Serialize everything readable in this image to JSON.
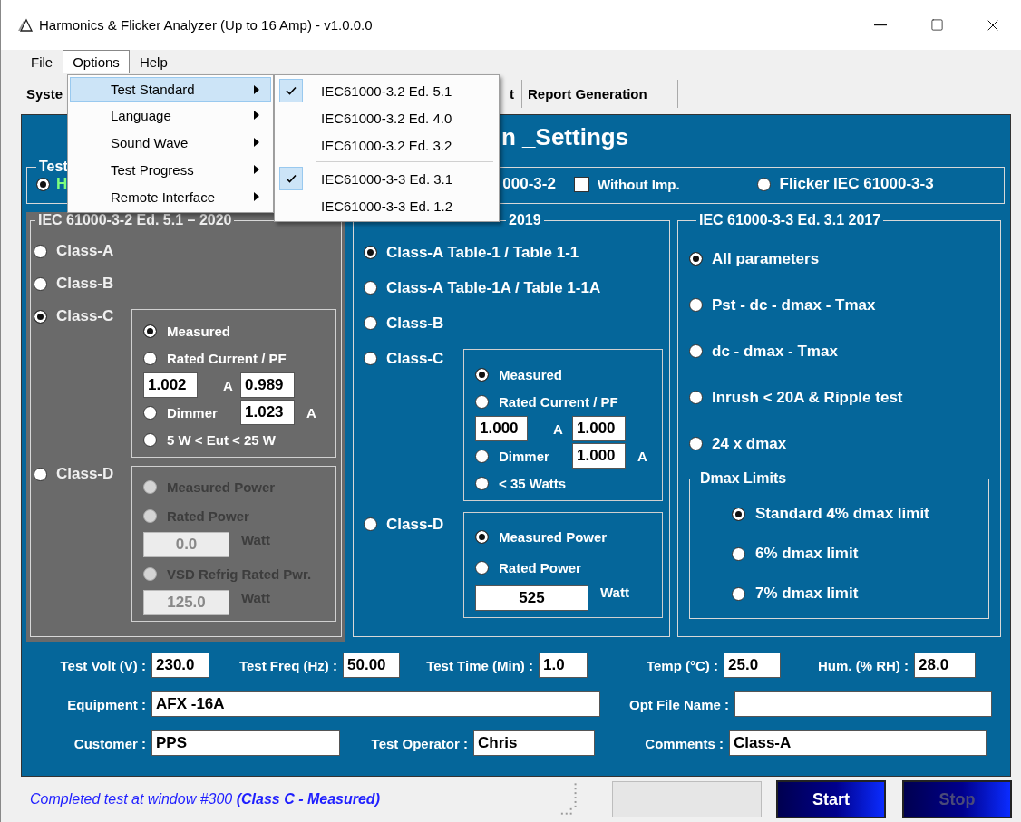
{
  "window": {
    "title": "Harmonics & Flicker Analyzer (Up to 16 Amp) - v1.0.0.0"
  },
  "menu_bar": [
    {
      "label": "File",
      "selected": false
    },
    {
      "label": "Options",
      "selected": true
    },
    {
      "label": "Help",
      "selected": false
    }
  ],
  "options_menu": [
    {
      "label": "Test Standard",
      "selected": true
    },
    {
      "label": "Language",
      "selected": false
    },
    {
      "label": "Sound Wave",
      "selected": false
    },
    {
      "label": "Test Progress",
      "selected": false
    },
    {
      "label": "Remote Interface",
      "selected": false
    }
  ],
  "test_standard_submenu": [
    {
      "label": "IEC61000-3.2 Ed. 5.1",
      "checked": true,
      "separator_before": false
    },
    {
      "label": "IEC61000-3.2 Ed. 4.0",
      "checked": false,
      "separator_before": false
    },
    {
      "label": "IEC61000-3.2 Ed. 3.2",
      "checked": false,
      "separator_before": false
    },
    {
      "label": "IEC61000-3-3 Ed. 3.1",
      "checked": true,
      "separator_before": true
    },
    {
      "label": "IEC61000-3-3 Ed. 1.2",
      "checked": false,
      "separator_before": false
    }
  ],
  "tabs": [
    {
      "label": "Syste",
      "selected": false
    },
    {
      "label": "t",
      "selected": false
    },
    {
      "label": "Report Generation",
      "selected": false
    }
  ],
  "panel_title": "n _Settings",
  "test_type": {
    "legend": "Test",
    "harmonics": {
      "label_start": "H",
      "label_end": "000-3-2",
      "selected": true
    },
    "without_imp": {
      "label": "Without Imp.",
      "checked": false
    },
    "flicker": {
      "label": "Flicker IEC 61000-3-3",
      "selected": false
    }
  },
  "columns": [
    {
      "legend": "IEC 61000-3-2 Ed. 5.1 – 2020",
      "active": false,
      "classes": [
        {
          "label": "Class-A",
          "selected": false
        },
        {
          "label": "Class-B",
          "selected": false
        },
        {
          "label": "Class-C",
          "selected": true,
          "options": {
            "disabled": false,
            "rows": [
              {
                "kind": "radio",
                "label": "Measured",
                "selected": true
              },
              {
                "kind": "radio",
                "label": "Rated Current / PF",
                "selected": false
              },
              {
                "kind": "pair",
                "value": "1.002",
                "unit": "A",
                "value2": "0.989"
              },
              {
                "kind": "radio_value",
                "label": "Dimmer",
                "selected": false,
                "value": "1.023",
                "unit": "A"
              },
              {
                "kind": "radio",
                "label": "5 W < Eut <  25 W",
                "selected": false
              }
            ]
          }
        },
        {
          "label": "Class-D",
          "selected": false,
          "options": {
            "disabled": true,
            "rows": [
              {
                "kind": "radio",
                "label": "Measured Power",
                "selected": false
              },
              {
                "kind": "radio",
                "label": "Rated Power",
                "selected": false
              },
              {
                "kind": "value",
                "value": "0.0",
                "unit": "Watt"
              },
              {
                "kind": "radio",
                "label": "VSD Refrig Rated Pwr.",
                "selected": false
              },
              {
                "kind": "value",
                "value": "125.0",
                "unit": "Watt"
              }
            ]
          }
        }
      ]
    },
    {
      "legend": "2019",
      "active": true,
      "classes": [
        {
          "label": "Class-A Table-1 / Table 1-1",
          "selected": true
        },
        {
          "label": "Class-A Table-1A / Table 1-1A",
          "selected": false
        },
        {
          "label": "Class-B",
          "selected": false
        },
        {
          "label": "Class-C",
          "selected": false,
          "options": {
            "disabled": false,
            "rows": [
              {
                "kind": "radio",
                "label": "Measured",
                "selected": true
              },
              {
                "kind": "radio",
                "label": "Rated Current / PF",
                "selected": false
              },
              {
                "kind": "pair",
                "value": "1.000",
                "unit": "A",
                "value2": "1.000"
              },
              {
                "kind": "radio_value",
                "label": "Dimmer",
                "selected": false,
                "value": "1.000",
                "unit": "A"
              },
              {
                "kind": "radio",
                "label": "< 35 Watts",
                "selected": false
              }
            ]
          }
        },
        {
          "label": "Class-D",
          "selected": false,
          "options": {
            "disabled": false,
            "rows": [
              {
                "kind": "radio",
                "label": "Measured Power",
                "selected": true
              },
              {
                "kind": "radio",
                "label": "Rated Power",
                "selected": false
              },
              {
                "kind": "value",
                "value": "525",
                "unit": "Watt"
              }
            ]
          }
        }
      ]
    }
  ],
  "flicker_settings": {
    "legend": "IEC 61000-3-3 Ed. 3.1 2017",
    "options": [
      {
        "label": "All parameters",
        "selected": true
      },
      {
        "label": "Pst - dc - dmax - Tmax",
        "selected": false
      },
      {
        "label": "dc - dmax - Tmax",
        "selected": false
      },
      {
        "label": "Inrush < 20A & Ripple test",
        "selected": false
      },
      {
        "label": "24 x dmax",
        "selected": false
      }
    ],
    "dmax_limits": {
      "legend": "Dmax Limits",
      "options": [
        {
          "label": "Standard 4% dmax limit",
          "selected": true
        },
        {
          "label": "6% dmax limit",
          "selected": false
        },
        {
          "label": "7% dmax limit",
          "selected": false
        }
      ]
    }
  },
  "fields": [
    [
      {
        "label": "Test Volt (V) :",
        "value": "230.0"
      },
      {
        "label": "Test Freq (Hz) :",
        "value": "50.00"
      },
      {
        "label": "Test Time (Min) :",
        "value": "1.0"
      },
      {
        "label": "Temp (°C) :",
        "value": "25.0"
      },
      {
        "label": "Hum. (% RH) :",
        "value": "28.0"
      }
    ],
    [
      {
        "label": "Equipment :",
        "value": "AFX -16A"
      },
      {
        "label": "Opt File Name :"
      }
    ],
    [
      {
        "label": "Customer :",
        "value": "PPS"
      },
      {
        "label": "Test Operator :",
        "value": "Chris"
      },
      {
        "label": "Comments :",
        "value": "Class-A"
      }
    ]
  ],
  "status_bar": {
    "message": "Completed test at window #300  **(Class C - Measured)**",
    "progress": {
      "level": 0
    },
    "buttons": [
      {
        "label": "Start",
        "disabled": false
      },
      {
        "label": "Stop",
        "disabled": true
      }
    ]
  }
}
